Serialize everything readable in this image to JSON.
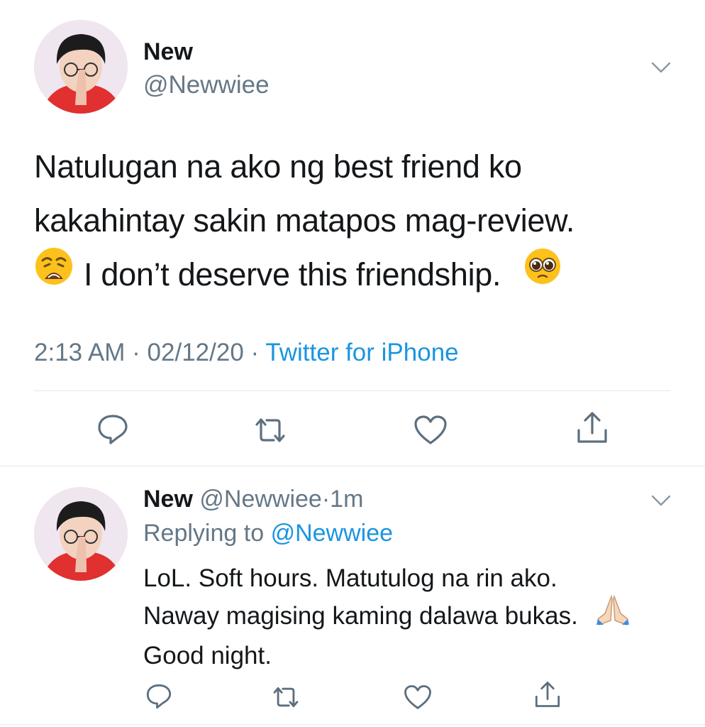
{
  "main_tweet": {
    "display_name": "New",
    "handle": "@Newwiee",
    "lines": [
      "Natulugan na ako ng best friend ko",
      "kakahintay sakin matapos mag-review.",
      "I don’t deserve this friendship."
    ],
    "time": "2:13 AM",
    "sep1": "·",
    "date": "02/12/20",
    "sep2": "·",
    "source": "Twitter for iPhone"
  },
  "reply": {
    "display_name": "New",
    "handle": "@Newwiee",
    "sep": "·",
    "age": "1m",
    "replying_label": "Replying to",
    "replying_handle": "@Newwiee",
    "lines": [
      "LoL. Soft hours. Matutulog na rin ako.",
      "Naway magising kaming dalawa bukas.",
      "Good night."
    ]
  },
  "icons": {
    "menu": "chevron-down-icon",
    "reply": "reply-icon",
    "retweet": "retweet-icon",
    "like": "heart-icon",
    "share": "share-icon"
  },
  "colors": {
    "text": "#14171a",
    "muted": "#657786",
    "link": "#1b95e0",
    "divider": "#e1e8ed"
  }
}
